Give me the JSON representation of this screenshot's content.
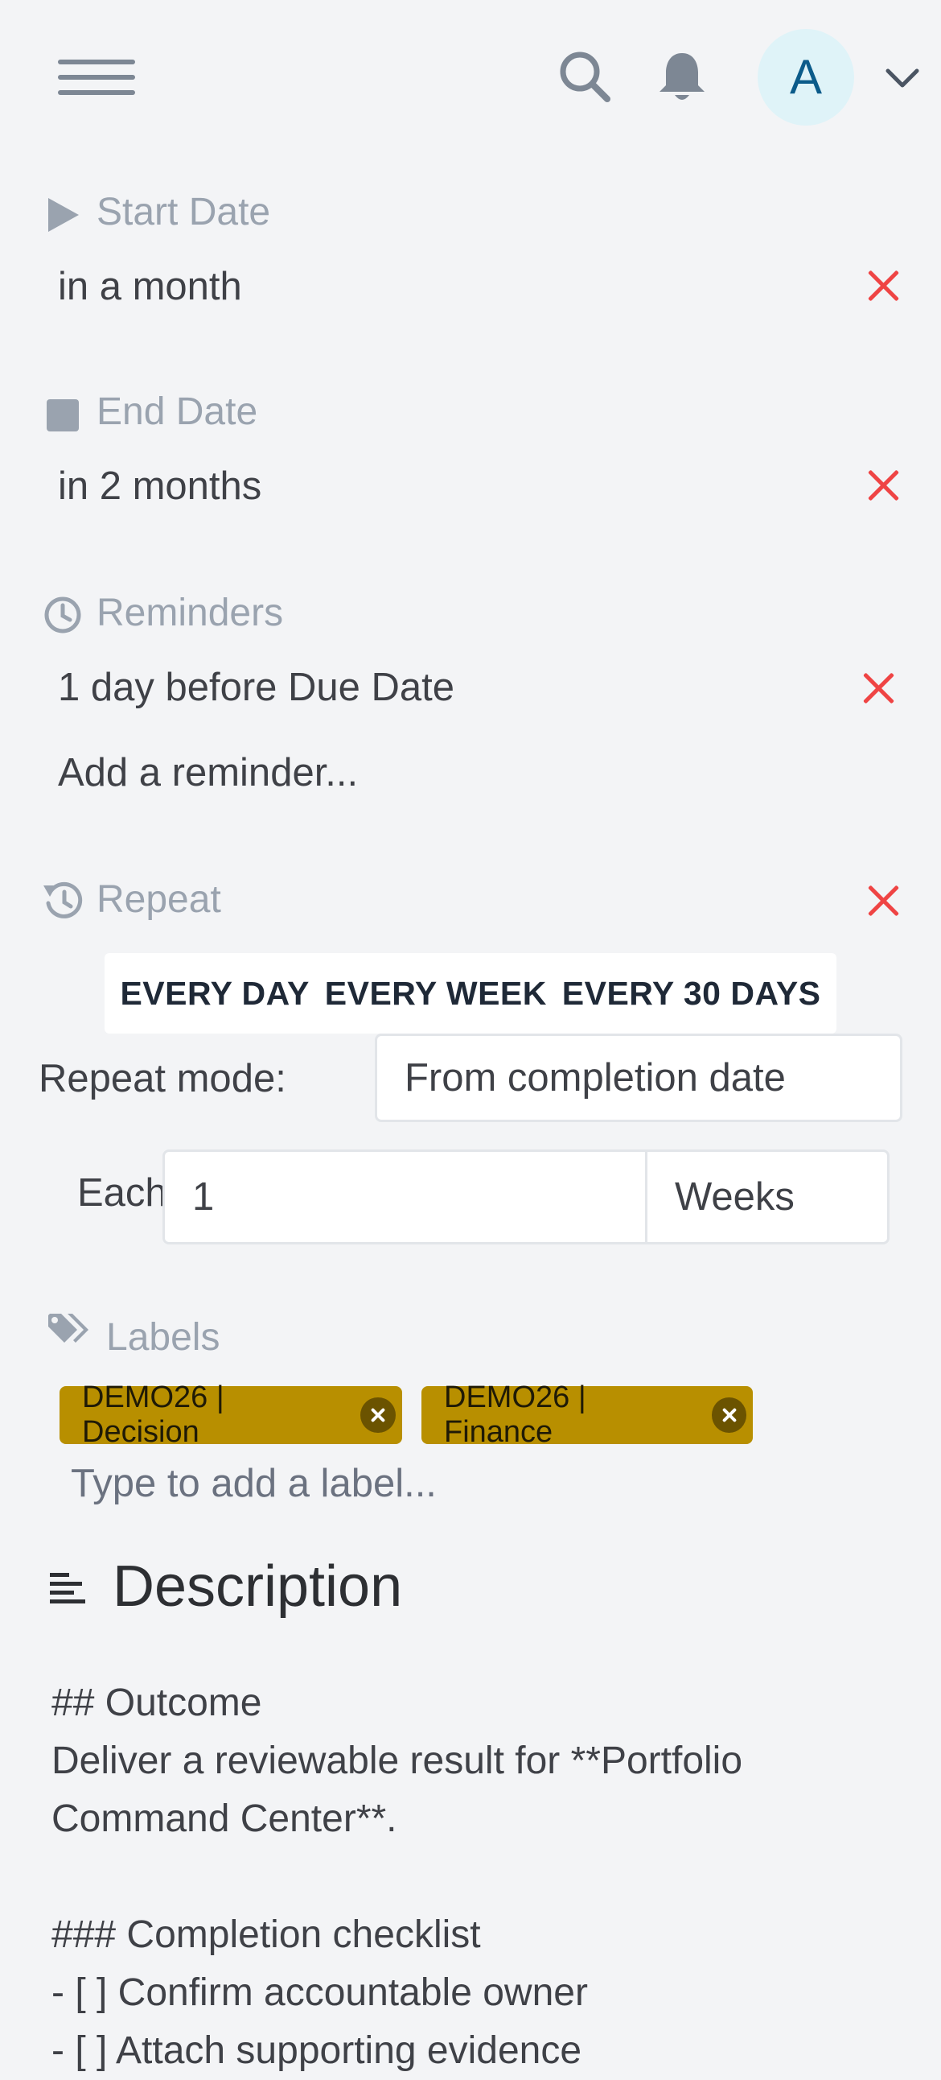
{
  "header": {
    "avatar_initial": "A",
    "icons": [
      "menu-icon",
      "search-icon",
      "bell-icon",
      "chevron-down-icon"
    ]
  },
  "start_date": {
    "label": "Start Date",
    "value": "in a month"
  },
  "end_date": {
    "label": "End Date",
    "value": "in 2 months"
  },
  "reminders": {
    "label": "Reminders",
    "items": [
      "1 day before Due Date"
    ],
    "add_placeholder": "Add a reminder..."
  },
  "repeat": {
    "label": "Repeat",
    "presets": [
      "EVERY DAY",
      "EVERY WEEK",
      "EVERY 30 DAYS"
    ],
    "mode_label": "Repeat mode:",
    "mode_value": "From completion date",
    "each_label": "Each",
    "each_value": "1",
    "unit_value": "Weeks"
  },
  "labels": {
    "label": "Labels",
    "chips": [
      "DEMO26 | Decision",
      "DEMO26 | Finance"
    ],
    "chip_color": "#b88f00",
    "input_placeholder": "Type to add a label..."
  },
  "description": {
    "title": "Description",
    "lines": [
      "## Outcome",
      "Deliver a reviewable result for **Portfolio",
      "Command Center**.",
      "",
      "### Completion checklist",
      "- [ ] Confirm accountable owner",
      "- [ ] Attach supporting evidence"
    ]
  },
  "colors": {
    "accent_remove": "#ef4444",
    "muted_label": "#9aa3af",
    "background": "#f3f4f6"
  }
}
